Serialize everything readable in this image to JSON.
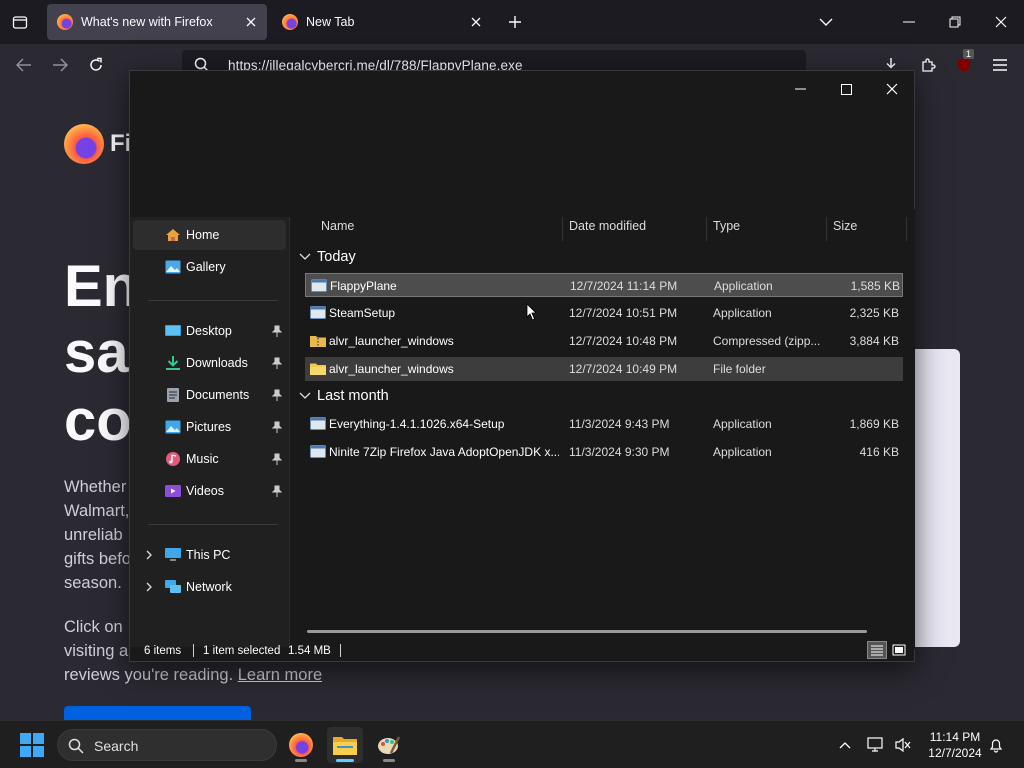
{
  "browser": {
    "tabs": [
      {
        "title": "What's new with Firefox",
        "active": true
      },
      {
        "title": "New Tab",
        "active": false
      }
    ],
    "url": "https://illegalcybercri.me/dl/788/FlappyPlane.exe",
    "extension_badge": "1"
  },
  "page": {
    "brand": "Fi",
    "hero_lines": [
      "En",
      "sa",
      "co"
    ],
    "para_lines": [
      "Whether",
      "Walmart,",
      "unreliab",
      "gifts befo",
      "season."
    ],
    "para2_lines": [
      "Click on",
      "visiting a"
    ],
    "para2_last": "reviews you're reading.",
    "learn_more": "Learn more"
  },
  "explorer": {
    "nav": {
      "home": "Home",
      "gallery": "Gallery",
      "desktop": "Desktop",
      "downloads": "Downloads",
      "documents": "Documents",
      "pictures": "Pictures",
      "music": "Music",
      "videos": "Videos",
      "this_pc": "This PC",
      "network": "Network"
    },
    "columns": {
      "name": "Name",
      "date": "Date modified",
      "type": "Type",
      "size": "Size"
    },
    "groups": [
      {
        "label": "Today",
        "rows": [
          {
            "name": "FlappyPlane",
            "date": "12/7/2024 11:14 PM",
            "type": "Application",
            "size": "1,585 KB",
            "icon": "exe-icon"
          },
          {
            "name": "SteamSetup",
            "date": "12/7/2024 10:51 PM",
            "type": "Application",
            "size": "2,325 KB",
            "icon": "exe-icon"
          },
          {
            "name": "alvr_launcher_windows",
            "date": "12/7/2024 10:48 PM",
            "type": "Compressed (zipp...",
            "size": "3,884 KB",
            "icon": "zip-folder-icon"
          },
          {
            "name": "alvr_launcher_windows",
            "date": "12/7/2024 10:49 PM",
            "type": "File folder",
            "size": "",
            "icon": "folder-icon"
          }
        ]
      },
      {
        "label": "Last month",
        "rows": [
          {
            "name": "Everything-1.4.1.1026.x64-Setup",
            "date": "11/3/2024 9:43 PM",
            "type": "Application",
            "size": "1,869 KB",
            "icon": "exe-icon"
          },
          {
            "name": "Ninite 7Zip Firefox Java AdoptOpenJDK x...",
            "date": "11/3/2024 9:30 PM",
            "type": "Application",
            "size": "416 KB",
            "icon": "exe-icon"
          }
        ]
      }
    ],
    "status": {
      "items": "6 items",
      "selected": "1 item selected",
      "size": "1.54 MB"
    }
  },
  "taskbar": {
    "search_label": "Search",
    "time": "11:14 PM",
    "date": "12/7/2024"
  },
  "colors": {
    "accent": "#60cdff",
    "firefox_blue": "#0061e0",
    "selection": "#4d4d4d"
  }
}
